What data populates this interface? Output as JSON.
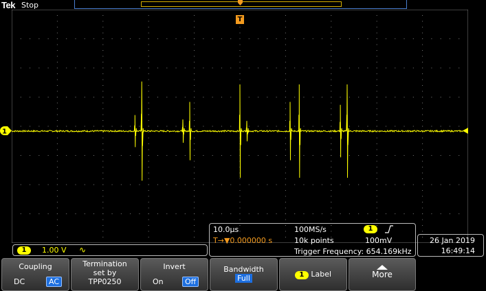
{
  "header": {
    "brand": "Tek",
    "run_state": "Stop"
  },
  "trigger_marker_label": "T",
  "channel_marker_label": "1",
  "channel_readout": {
    "channel": "1",
    "scale": "1.00 V",
    "bw_limit_icon": "∿"
  },
  "acquisition": {
    "horizontal_scale": "10.0µs",
    "sample_rate": "100MS/s",
    "trigger_channel": "1",
    "trigger_slope_icon": "rising-edge-icon",
    "trigger_position_prefix": "T",
    "trigger_position": "0.000000 s",
    "record_length": "10k points",
    "trigger_level": "100mV",
    "trigger_frequency": "Trigger Frequency: 654.169kHz"
  },
  "datetime": {
    "date": "26 Jan  2019",
    "time": "16:49:14"
  },
  "menu": {
    "coupling": {
      "title": "Coupling",
      "opt1": "DC",
      "opt2": "AC"
    },
    "termination": {
      "line1": "Termination",
      "line2": "set by",
      "line3": "TPP0250"
    },
    "invert": {
      "title": "Invert",
      "opt1": "On",
      "opt2": "Off"
    },
    "bandwidth": {
      "title": "Bandwidth",
      "value": "Full"
    },
    "label": {
      "channel": "1",
      "title": "Label"
    },
    "more": {
      "title": "More"
    }
  },
  "colors": {
    "channel1": "#ffff00",
    "trigger": "#f39a1e",
    "selected": "#1d6fe0",
    "record_bar": "#4a7fd0"
  },
  "waveform": {
    "baseline_volts": 0,
    "noise_volts_pp": 0.05,
    "spikes": [
      {
        "time_us": -23.0,
        "volts": 0.55
      },
      {
        "time_us": -21.5,
        "volts": 1.7
      },
      {
        "time_us": -12.5,
        "volts": 0.4
      },
      {
        "time_us": -11.0,
        "volts": 1.0
      },
      {
        "time_us": 0.0,
        "volts": 1.6
      },
      {
        "time_us": 1.5,
        "volts": 0.35
      },
      {
        "time_us": 11.0,
        "volts": 1.0
      },
      {
        "time_us": 13.0,
        "volts": 1.6
      },
      {
        "time_us": 22.0,
        "volts": 0.9
      },
      {
        "time_us": 23.5,
        "volts": 1.6
      }
    ]
  }
}
